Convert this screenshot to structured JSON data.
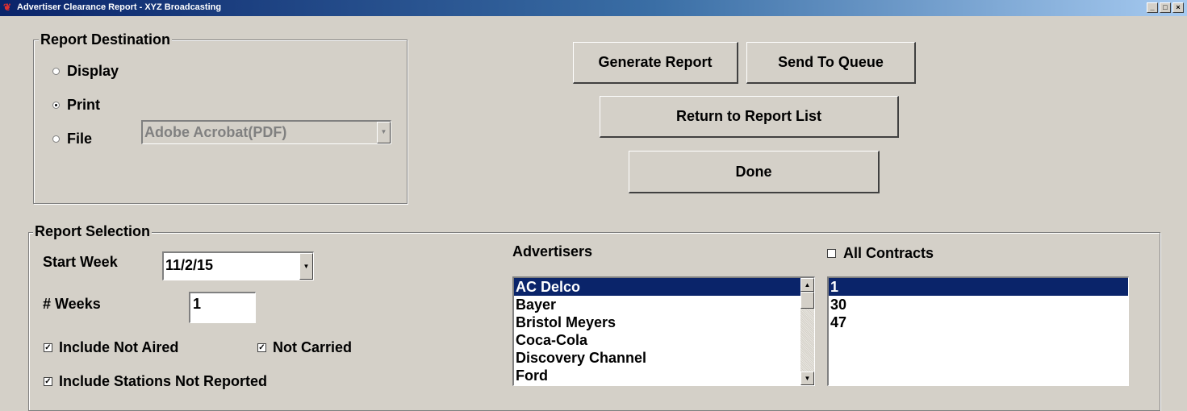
{
  "window": {
    "title": "Advertiser Clearance Report - XYZ Broadcasting"
  },
  "icons": {
    "app": "app-icon",
    "radio": "radio-button",
    "check": "checkbox",
    "dropdown": "chevron-down-icon",
    "scroll_up": "chevron-up-icon",
    "scroll_down": "chevron-down-icon"
  },
  "report_destination": {
    "label": "Report Destination",
    "options": [
      {
        "label": "Display",
        "selected": false
      },
      {
        "label": "Print",
        "selected": true
      },
      {
        "label": "File",
        "selected": false
      }
    ],
    "file_format": "Adobe Acrobat(PDF)"
  },
  "actions": {
    "generate": "Generate Report",
    "queue": "Send To Queue",
    "return": "Return to Report List",
    "done": "Done"
  },
  "report_selection": {
    "label": "Report Selection",
    "start_week_label": "Start Week",
    "start_week_value": "11/2/15",
    "weeks_label": "# Weeks",
    "weeks_value": "1",
    "include_not_aired": {
      "label": "Include Not Aired",
      "checked": true
    },
    "not_carried": {
      "label": "Not Carried",
      "checked": true
    },
    "include_stations_not_reported": {
      "label": "Include Stations Not Reported",
      "checked": true
    },
    "advertisers_label": "Advertisers",
    "advertisers": [
      "AC Delco",
      "Bayer",
      "Bristol Meyers",
      "Coca-Cola",
      "Discovery Channel",
      "Ford"
    ],
    "advertisers_selected": 0,
    "all_contracts": {
      "label": "All Contracts",
      "checked": false
    },
    "contracts": [
      "1",
      "30",
      "47"
    ],
    "contracts_selected": 0
  }
}
